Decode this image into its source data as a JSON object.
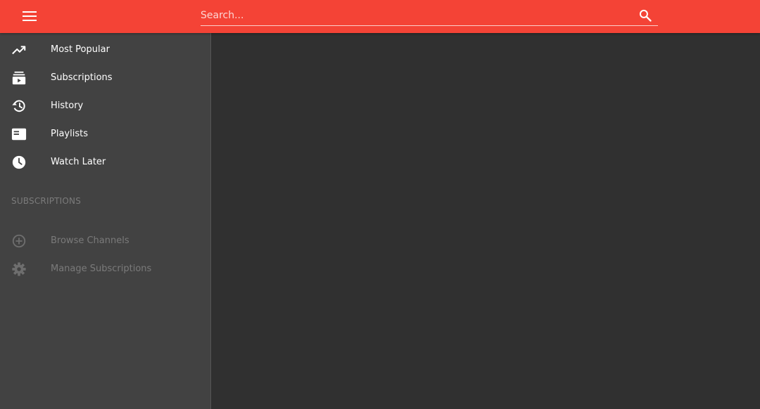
{
  "colors": {
    "toolbar": "#f44336",
    "sidebar": "#424242",
    "content": "#303030",
    "muted_text": "#7a7a7a"
  },
  "toolbar": {
    "menu_icon": "hamburger-menu-icon",
    "search": {
      "placeholder": "Search...",
      "value": "",
      "icon": "search-icon"
    }
  },
  "sidebar": {
    "items": [
      {
        "label": "Most Popular",
        "icon": "trending-up-icon"
      },
      {
        "label": "Subscriptions",
        "icon": "subscriptions-icon"
      },
      {
        "label": "History",
        "icon": "history-icon"
      },
      {
        "label": "Playlists",
        "icon": "playlist-icon"
      },
      {
        "label": "Watch Later",
        "icon": "clock-icon"
      }
    ],
    "section_title": "SUBSCRIPTIONS",
    "subscription_actions": [
      {
        "label": "Browse Channels",
        "icon": "add-circle-icon"
      },
      {
        "label": "Manage Subscriptions",
        "icon": "gear-icon"
      }
    ]
  }
}
